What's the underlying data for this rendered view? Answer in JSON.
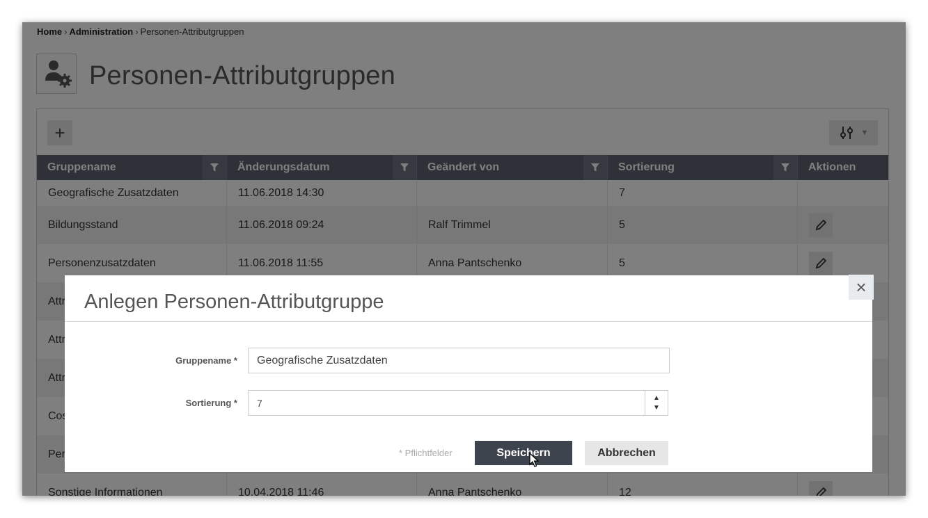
{
  "breadcrumb": {
    "home": "Home",
    "sep": "›",
    "admin": "Administration",
    "current": "Personen-Attributgruppen"
  },
  "page": {
    "title": "Personen-Attributgruppen",
    "icon": "user-gear-icon"
  },
  "toolbar": {
    "add_label": "+",
    "caret": "▼"
  },
  "grid": {
    "columns": [
      "Gruppename",
      "Änderungsdatum",
      "Geändert von",
      "Sortierung",
      "Aktionen"
    ],
    "rows": [
      {
        "name": "Geografische Zusatzdaten",
        "date": "11.06.2018 14:30",
        "by": "",
        "sort": "7"
      },
      {
        "name": "Bildungsstand",
        "date": "11.06.2018 09:24",
        "by": "Ralf Trimmel",
        "sort": "5"
      },
      {
        "name": "Personenzusatzdaten",
        "date": "11.06.2018 11:55",
        "by": "Anna Pantschenko",
        "sort": "5"
      },
      {
        "name": "Attr",
        "date": "",
        "by": "",
        "sort": ""
      },
      {
        "name": "Attr",
        "date": "",
        "by": "",
        "sort": ""
      },
      {
        "name": "Attr",
        "date": "",
        "by": "",
        "sort": ""
      },
      {
        "name": "Cos",
        "date": "",
        "by": "",
        "sort": ""
      },
      {
        "name": "Per",
        "date": "",
        "by": "",
        "sort": ""
      },
      {
        "name": "Sonstige Informationen",
        "date": "10.04.2018 11:46",
        "by": "Anna Pantschenko",
        "sort": "12"
      }
    ]
  },
  "modal": {
    "title": "Anlegen Personen-Attributgruppe",
    "close": "×",
    "fields": {
      "name_label": "Gruppename *",
      "name_value": "Geografische Zusatzdaten",
      "sort_label": "Sortierung *",
      "sort_value": "7",
      "step_up": "▲",
      "step_down": "▼"
    },
    "required_note": "* Pflichtfelder",
    "save_label": "Speichern",
    "cancel_label": "Abbrechen"
  },
  "colors": {
    "header_bg": "#5d6470",
    "save_bg": "#3e444e",
    "overlay": "rgba(0,0,0,0.5)"
  }
}
